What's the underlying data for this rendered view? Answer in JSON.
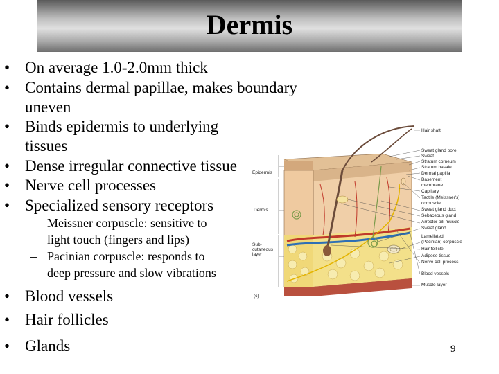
{
  "slide": {
    "title": "Dermis",
    "page_number": "9"
  },
  "bullets": {
    "b1": "On average 1.0-2.0mm thick",
    "b2a": "Contains dermal papillae, makes boundary",
    "b2b": "uneven",
    "b3a": "Binds epidermis to underlying",
    "b3b": "tissues",
    "b4": "Dense irregular connective tissue",
    "b5": "Nerve cell processes",
    "b6": "Specialized sensory receptors",
    "s1a": "Meissner corpuscle:  sensitive to",
    "s1b": "light touch (fingers and lips)",
    "s2a": "Pacinian corpuscle:  responds to",
    "s2b": "deep pressure and slow vibrations",
    "b7": "Blood vessels",
    "b8": "Hair follicles",
    "b9": "Glands",
    "bullet_glyph": "•",
    "dash_glyph": "–"
  },
  "figure": {
    "left_labels": {
      "epidermis": "Epidermis",
      "dermis": "Dermis",
      "sub1": "Sub-",
      "sub2": "cutaneous",
      "sub3": "layer",
      "muscle": "(c)"
    },
    "right_labels": [
      "Hair shaft",
      "Sweat gland pore",
      "Sweat",
      "Stratum corneum",
      "Stratum basale",
      "Dermal papilla",
      "Basement",
      "membrane",
      "Capillary",
      "Tactile (Meissner's)",
      "corpuscle",
      "Sweat gland duct",
      "Sebaceous gland",
      "Arrector pili muscle",
      "Sweat gland",
      "Lamellated",
      "(Pacinian) corpuscle",
      "Hair follicle",
      "Adipose tissue",
      "Nerve cell process",
      "Blood vessels",
      "Muscle layer"
    ]
  },
  "colors": {
    "epidermis": "#d9b48a",
    "dermis": "#f0cfa8",
    "subcutaneous": "#f3e08a",
    "blood_red": "#c0392b",
    "blood_blue": "#2e6fb5",
    "hair": "#6b4b3a"
  }
}
